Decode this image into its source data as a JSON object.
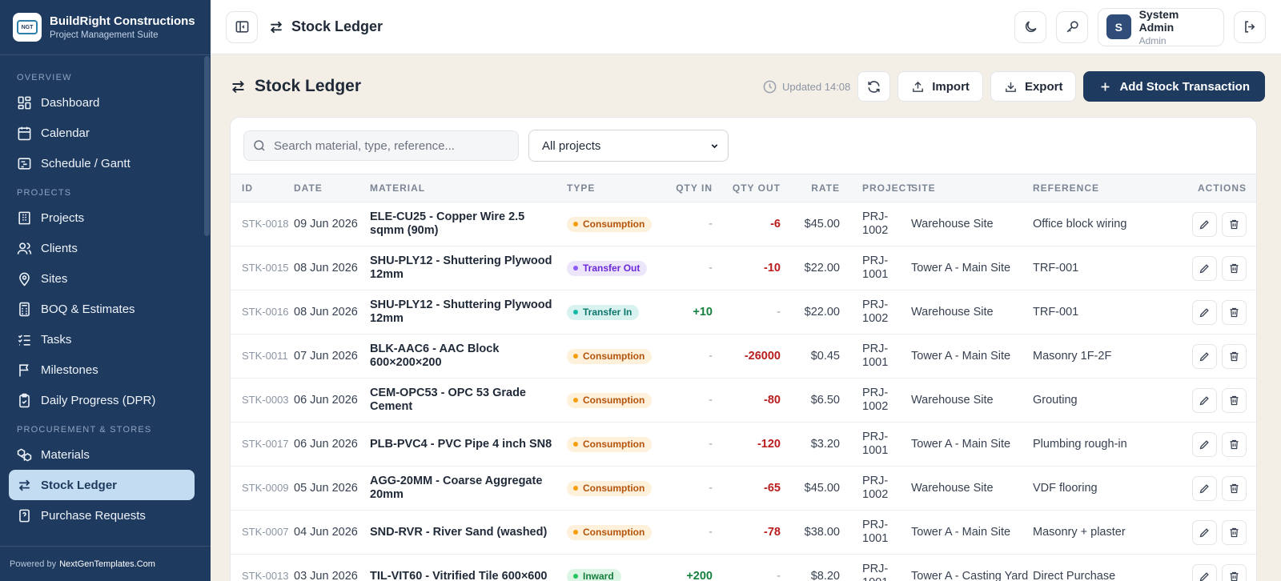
{
  "brand": {
    "logo_text": "NGT",
    "title": "BuildRight Constructions",
    "subtitle": "Project Management Suite"
  },
  "sidebar": {
    "sections": {
      "overview": "OVERVIEW",
      "projects": "PROJECTS",
      "procurement": "PROCUREMENT & STORES"
    },
    "items": [
      {
        "label": "Dashboard",
        "icon": "grid-icon"
      },
      {
        "label": "Calendar",
        "icon": "calendar-icon"
      },
      {
        "label": "Schedule / Gantt",
        "icon": "gantt-icon"
      },
      {
        "label": "Projects",
        "icon": "building-icon"
      },
      {
        "label": "Clients",
        "icon": "users-icon"
      },
      {
        "label": "Sites",
        "icon": "map-pin-icon"
      },
      {
        "label": "BOQ & Estimates",
        "icon": "calculator-icon"
      },
      {
        "label": "Tasks",
        "icon": "checklist-icon"
      },
      {
        "label": "Milestones",
        "icon": "flag-icon"
      },
      {
        "label": "Daily Progress (DPR)",
        "icon": "clipboard-icon"
      },
      {
        "label": "Materials",
        "icon": "boxes-icon"
      },
      {
        "label": "Stock Ledger",
        "icon": "swap-icon",
        "active": true
      },
      {
        "label": "Purchase Requests",
        "icon": "file-question-icon"
      }
    ],
    "powered_prefix": "Powered by",
    "powered_link": "NextGenTemplates.Com"
  },
  "topbar": {
    "title": "Stock Ledger",
    "user": {
      "initial": "S",
      "name": "System Admin",
      "role": "Admin"
    }
  },
  "page": {
    "title": "Stock Ledger",
    "updated": "Updated 14:08",
    "import_label": "Import",
    "export_label": "Export",
    "add_label": "Add Stock Transaction"
  },
  "filters": {
    "search_placeholder": "Search material, type, reference...",
    "project_select": "All projects"
  },
  "table": {
    "columns": [
      "ID",
      "DATE",
      "MATERIAL",
      "TYPE",
      "QTY IN",
      "QTY OUT",
      "RATE",
      "PROJECT",
      "SITE",
      "REFERENCE",
      "ACTIONS"
    ],
    "rows": [
      {
        "id": "STK-0018",
        "date": "09 Jun 2026",
        "material": "ELE-CU25 - Copper Wire 2.5 sqmm (90m)",
        "type": "Consumption",
        "qty_in": "-",
        "qty_out": "-6",
        "rate": "$45.00",
        "project": "PRJ-1002",
        "site": "Warehouse Site",
        "reference": "Office block wiring"
      },
      {
        "id": "STK-0015",
        "date": "08 Jun 2026",
        "material": "SHU-PLY12 - Shuttering Plywood 12mm",
        "type": "Transfer Out",
        "qty_in": "-",
        "qty_out": "-10",
        "rate": "$22.00",
        "project": "PRJ-1001",
        "site": "Tower A - Main Site",
        "reference": "TRF-001"
      },
      {
        "id": "STK-0016",
        "date": "08 Jun 2026",
        "material": "SHU-PLY12 - Shuttering Plywood 12mm",
        "type": "Transfer In",
        "qty_in": "+10",
        "qty_out": "-",
        "rate": "$22.00",
        "project": "PRJ-1002",
        "site": "Warehouse Site",
        "reference": "TRF-001"
      },
      {
        "id": "STK-0011",
        "date": "07 Jun 2026",
        "material": "BLK-AAC6 - AAC Block 600×200×200",
        "type": "Consumption",
        "qty_in": "-",
        "qty_out": "-26000",
        "rate": "$0.45",
        "project": "PRJ-1001",
        "site": "Tower A - Main Site",
        "reference": "Masonry 1F-2F"
      },
      {
        "id": "STK-0003",
        "date": "06 Jun 2026",
        "material": "CEM-OPC53 - OPC 53 Grade Cement",
        "type": "Consumption",
        "qty_in": "-",
        "qty_out": "-80",
        "rate": "$6.50",
        "project": "PRJ-1002",
        "site": "Warehouse Site",
        "reference": "Grouting"
      },
      {
        "id": "STK-0017",
        "date": "06 Jun 2026",
        "material": "PLB-PVC4 - PVC Pipe 4 inch SN8",
        "type": "Consumption",
        "qty_in": "-",
        "qty_out": "-120",
        "rate": "$3.20",
        "project": "PRJ-1001",
        "site": "Tower A - Main Site",
        "reference": "Plumbing rough-in"
      },
      {
        "id": "STK-0009",
        "date": "05 Jun 2026",
        "material": "AGG-20MM - Coarse Aggregate 20mm",
        "type": "Consumption",
        "qty_in": "-",
        "qty_out": "-65",
        "rate": "$45.00",
        "project": "PRJ-1002",
        "site": "Warehouse Site",
        "reference": "VDF flooring"
      },
      {
        "id": "STK-0007",
        "date": "04 Jun 2026",
        "material": "SND-RVR - River Sand (washed)",
        "type": "Consumption",
        "qty_in": "-",
        "qty_out": "-78",
        "rate": "$38.00",
        "project": "PRJ-1001",
        "site": "Tower A - Main Site",
        "reference": "Masonry + plaster"
      },
      {
        "id": "STK-0013",
        "date": "03 Jun 2026",
        "material": "TIL-VIT60 - Vitrified Tile 600×600",
        "type": "Inward",
        "qty_in": "+200",
        "qty_out": "-",
        "rate": "$8.20",
        "project": "PRJ-1001",
        "site": "Tower A - Casting Yard",
        "reference": "Direct Purchase"
      }
    ]
  },
  "colors": {
    "sidebar_bg": "#1e3a5f",
    "active_item_bg": "#c4dcf1",
    "primary": "#1e3a5f",
    "qty_in": "#15803d",
    "qty_out": "#b91c1c"
  }
}
